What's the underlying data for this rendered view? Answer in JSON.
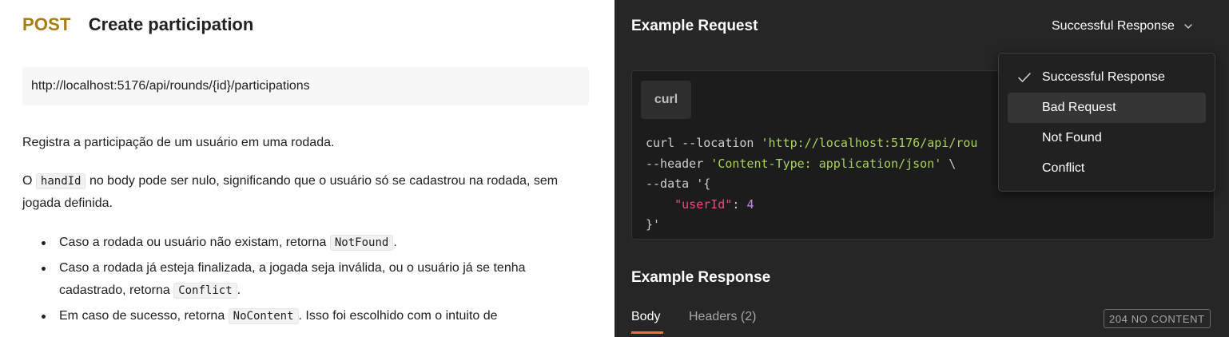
{
  "doc": {
    "method": "POST",
    "endpoint_name": "Create participation",
    "url": "http://localhost:5176/api/rounds/{id}/participations",
    "description": "Registra a participação de um usuário em uma rodada.",
    "para2": {
      "prefix": "O",
      "code": "handId",
      "text": "no body pode ser nulo, significando que o usuário só se cadastrou na rodada, sem jogada definida."
    },
    "bullets": [
      {
        "pre": "Caso a rodada ou usuário não existam, retorna",
        "code": "NotFound",
        "post": "."
      },
      {
        "pre": "Caso a rodada já esteja finalizada, a jogada seja inválida, ou o usuário já se tenha cadastrado, retorna",
        "code": "Conflict",
        "post": "."
      },
      {
        "pre": "Em caso de sucesso, retorna",
        "code": "NoContent",
        "post": ". Isso foi escolhido com o intuito de"
      }
    ]
  },
  "example": {
    "request_title": "Example Request",
    "selected_response": "Successful Response",
    "language": "curl",
    "code": {
      "l1_cmd": "curl --location ",
      "l1_url": "'http://localhost:5176/api/rou",
      "l2_flag": "--header ",
      "l2_val": "'Content-Type: application/json'",
      "l2_tail": " \\",
      "l3": "--data '{",
      "l4_indent": "    ",
      "l4_key": "\"userId\"",
      "l4_colon": ": ",
      "l4_val": "4",
      "l5": "}'"
    },
    "response_title": "Example Response",
    "tabs": {
      "body": "Body",
      "headers": "Headers (2)"
    },
    "status": "204 NO CONTENT"
  },
  "menu": {
    "items": [
      {
        "label": "Successful Response",
        "selected": true
      },
      {
        "label": "Bad Request",
        "selected": false
      },
      {
        "label": "Not Found",
        "selected": false
      },
      {
        "label": "Conflict",
        "selected": false
      }
    ]
  },
  "colors": {
    "method": "#a87c12",
    "accent_tab": "#ff6c37",
    "string": "#a8d25e",
    "key": "#ee4b7c",
    "number": "#c18cf0"
  }
}
